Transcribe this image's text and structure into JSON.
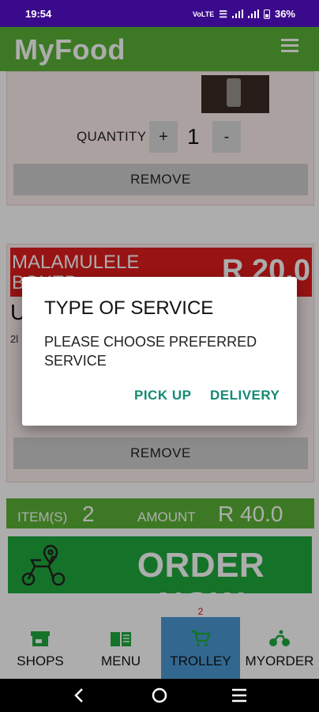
{
  "status_bar": {
    "time": "19:54",
    "network": "VoLTE",
    "battery": "36%"
  },
  "app_bar": {
    "title": "MyFood",
    "menu_icon": "hamburger-menu-icon"
  },
  "cart_items": [
    {
      "quantity_label": "QUANTITY",
      "plus_label": "+",
      "quantity": "1",
      "minus_label": "-",
      "remove_label": "REMOVE"
    },
    {
      "shop_name": "MALAMULELE BOXED",
      "price": "R 20.0",
      "item_name": "U",
      "item_detail": "2l",
      "remove_label": "REMOVE"
    }
  ],
  "summary": {
    "items_label": "ITEM(S)",
    "items_count": "2",
    "amount_label": "AMOUNT",
    "amount_value": "R 40.0"
  },
  "order_button": {
    "label": "ORDER NOW",
    "icon": "delivery-scooter-icon"
  },
  "dialog": {
    "title": "TYPE OF SERVICE",
    "message": "PLEASE CHOOSE PREFERRED SERVICE",
    "pickup_label": "PICK UP",
    "delivery_label": "DELIVERY"
  },
  "bottom_nav": {
    "items": [
      {
        "label": "SHOPS",
        "icon": "store-icon"
      },
      {
        "label": "MENU",
        "icon": "book-icon"
      },
      {
        "label": "TROLLEY",
        "icon": "cart-icon",
        "badge": "2",
        "active": true
      },
      {
        "label": "MYORDER",
        "icon": "motorbike-icon"
      }
    ]
  },
  "colors": {
    "app_bar": "#5ab336",
    "status_bar": "#3a0a8c",
    "shop_banner": "#e01c1c",
    "order_button": "#1faa3d",
    "nav_active": "#4a9ad4",
    "dialog_button": "#138a73"
  }
}
